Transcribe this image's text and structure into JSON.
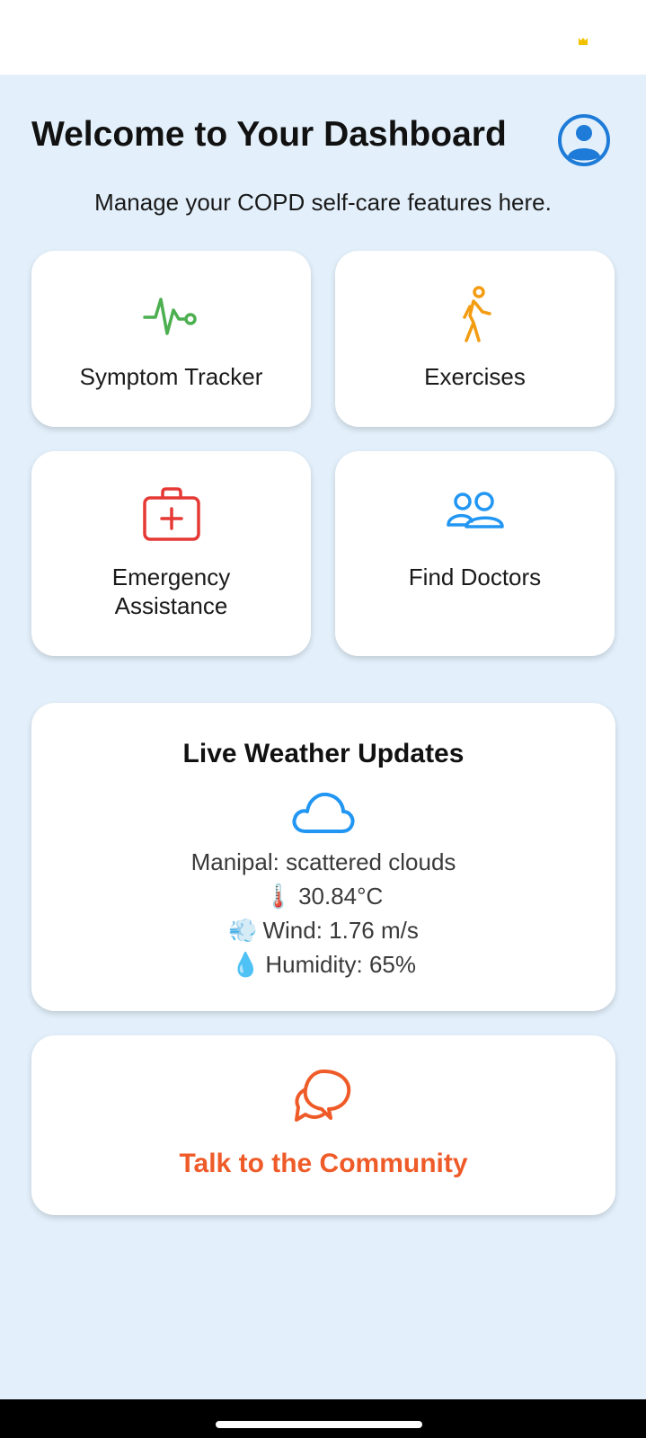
{
  "header": {
    "title": "Welcome to Your Dashboard",
    "subtitle": "Manage your COPD self-care features here.",
    "profile_icon": "user-circle-icon"
  },
  "tiles": [
    {
      "label": "Symptom Tracker",
      "icon": "activity-pulse-icon",
      "color": "#4CAF50"
    },
    {
      "label": "Exercises",
      "icon": "walking-person-icon",
      "color": "#F39C12"
    },
    {
      "label": "Emergency\nAssistance",
      "icon": "first-aid-kit-icon",
      "color": "#E53935"
    },
    {
      "label": "Find Doctors",
      "icon": "people-icon",
      "color": "#2196F3"
    }
  ],
  "weather": {
    "title": "Live Weather Updates",
    "icon": "cloud-icon",
    "location_line": "Manipal: scattered clouds",
    "temperature_emoji": "🌡️",
    "temperature": "30.84°C",
    "wind_emoji": "💨",
    "wind": "Wind: 1.76 m/s",
    "humidity_emoji": "💧",
    "humidity": "Humidity: 65%"
  },
  "community": {
    "label": "Talk to the Community",
    "icon": "chat-bubbles-icon",
    "color": "#EF5B28"
  },
  "colors": {
    "background": "#E3F0FB",
    "accent_blue": "#1E7BD8"
  }
}
